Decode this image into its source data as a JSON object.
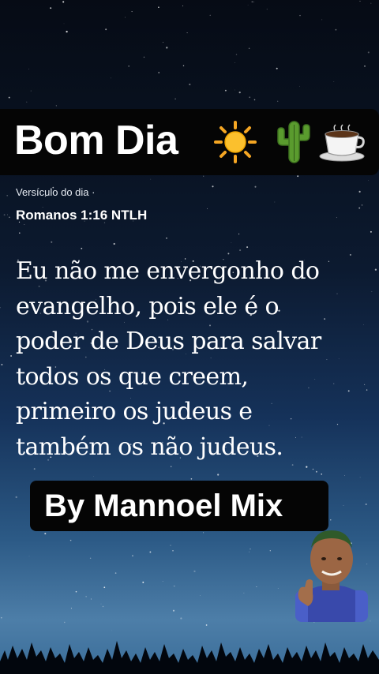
{
  "header": {
    "title": "Bom Dia",
    "emoji_icons": [
      "sun-icon",
      "cactus-icon",
      "coffee-cup-icon"
    ]
  },
  "verse": {
    "caption": "Versículo do dia ·",
    "reference": "Romanos 1:16 NTLH",
    "lines": [
      "Eu não me envergonho do",
      "evangelho, pois ele é o",
      "poder de Deus para salvar",
      "todos os que creem,",
      "primeiro os judeus e",
      "também os não judeus."
    ]
  },
  "credit": {
    "label": "By Mannoel Mix"
  },
  "colors": {
    "banner_background": "#050505",
    "text": "#ffffff",
    "sky_top": "#060b15",
    "sky_bottom": "#4d7ea8",
    "caption_text": "#e6ebf2"
  }
}
